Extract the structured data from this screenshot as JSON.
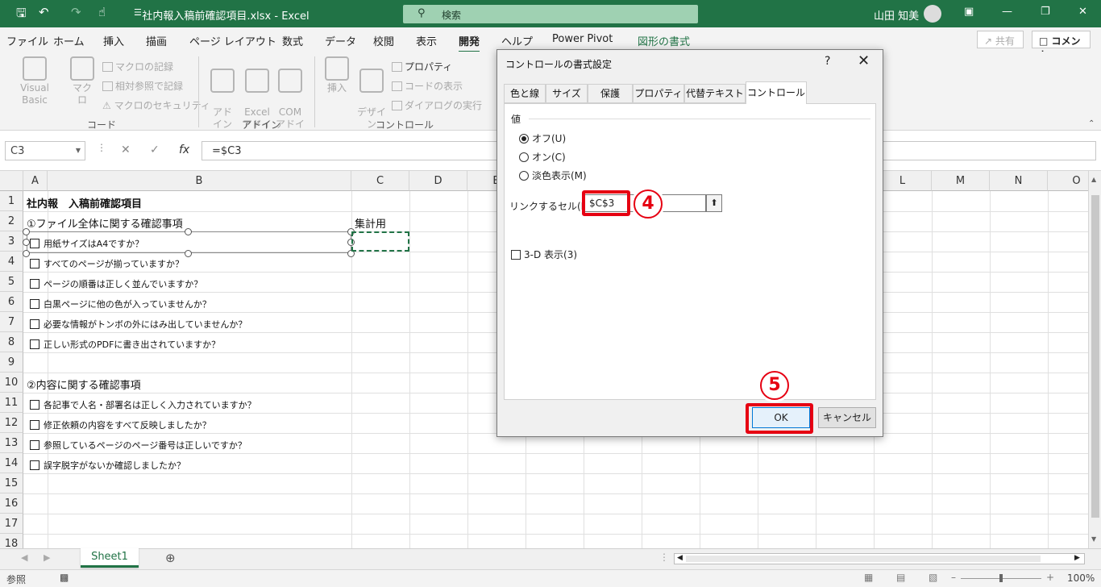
{
  "titlebar": {
    "title": "社内報入稿前確認項目.xlsx  -  Excel",
    "search_placeholder": "検索",
    "user": "山田 知美",
    "colors": {
      "accent": "#217346",
      "search_bg": "#9fd1b2"
    }
  },
  "tabs": [
    "ファイル",
    "ホーム",
    "挿入",
    "描画",
    "ページ レイアウト",
    "数式",
    "データ",
    "校閲",
    "表示",
    "開発",
    "ヘルプ",
    "Power Pivot",
    "図形の書式"
  ],
  "active_tab": "開発",
  "share_label": "共有",
  "comment_label": "コメント",
  "ribbon": {
    "vba": "Visual Basic",
    "macro": "マクロ",
    "record_macro": "マクロの記録",
    "relative_ref": "相対参照で記録",
    "macro_security": "マクロのセキュリティ",
    "code_group": "コード",
    "addin": "アド\nイン",
    "excel_addin": "Excel\nアドイン",
    "com_addin": "COM\nアドイン",
    "addin_group": "アドイン",
    "insert": "挿入",
    "design_mode": "デザイン\nモード",
    "properties": "プロパティ",
    "view_code": "コードの表示",
    "run_dialog": "ダイアログの実行",
    "controls_group": "コントロール"
  },
  "formula_bar": {
    "name_box": "C3",
    "formula": "=$C3"
  },
  "columns": [
    "A",
    "B",
    "C",
    "D",
    "E",
    "F",
    "G",
    "H",
    "I",
    "J",
    "K",
    "L",
    "M",
    "N",
    "O"
  ],
  "rows": [
    "1",
    "2",
    "3",
    "4",
    "5",
    "6",
    "7",
    "8",
    "9",
    "10",
    "11",
    "12",
    "13",
    "14",
    "15",
    "16",
    "17",
    "18"
  ],
  "cells": {
    "a1": "社内報　入稿前確認項目",
    "a2": "①ファイル全体に関する確認事項",
    "c2": "集計用",
    "a10": "②内容に関する確認事項"
  },
  "checklist": [
    "用紙サイズはA4ですか？",
    "すべてのページが揃っていますか？",
    "ページの順番は正しく並んでいますか？",
    "白黒ページに他の色が入っていませんか？",
    "必要な情報がトンボの外にはみ出していませんか？",
    "正しい形式のPDFに書き出されていますか？",
    "各記事で人名・部署名は正しく入力されていますか？",
    "修正依頼の内容をすべて反映しましたか？",
    "参照しているページのページ番号は正しいですか？",
    "誤字脱字がないか確認しましたか？"
  ],
  "sheet_tab": "Sheet1",
  "status": {
    "mode": "参照",
    "zoom": "100%"
  },
  "dialog": {
    "title": "コントロールの書式設定",
    "help": "?",
    "tabs": [
      "色と線",
      "サイズ",
      "保護",
      "プロパティ",
      "代替テキスト",
      "コントロール"
    ],
    "active_tab": "コントロール",
    "section": "値",
    "radio_off": "オフ(U)",
    "radio_on": "オン(C)",
    "radio_mixed": "淡色表示(M)",
    "selected": "オフ(U)",
    "link_label": "リンクするセル(L):",
    "link_value": "$C$3",
    "threed": "3-D 表示(3)",
    "ok": "OK",
    "cancel": "キャンセル"
  },
  "annotations": {
    "step4": "4",
    "step5": "5",
    "highlight_color": "#e60012"
  }
}
